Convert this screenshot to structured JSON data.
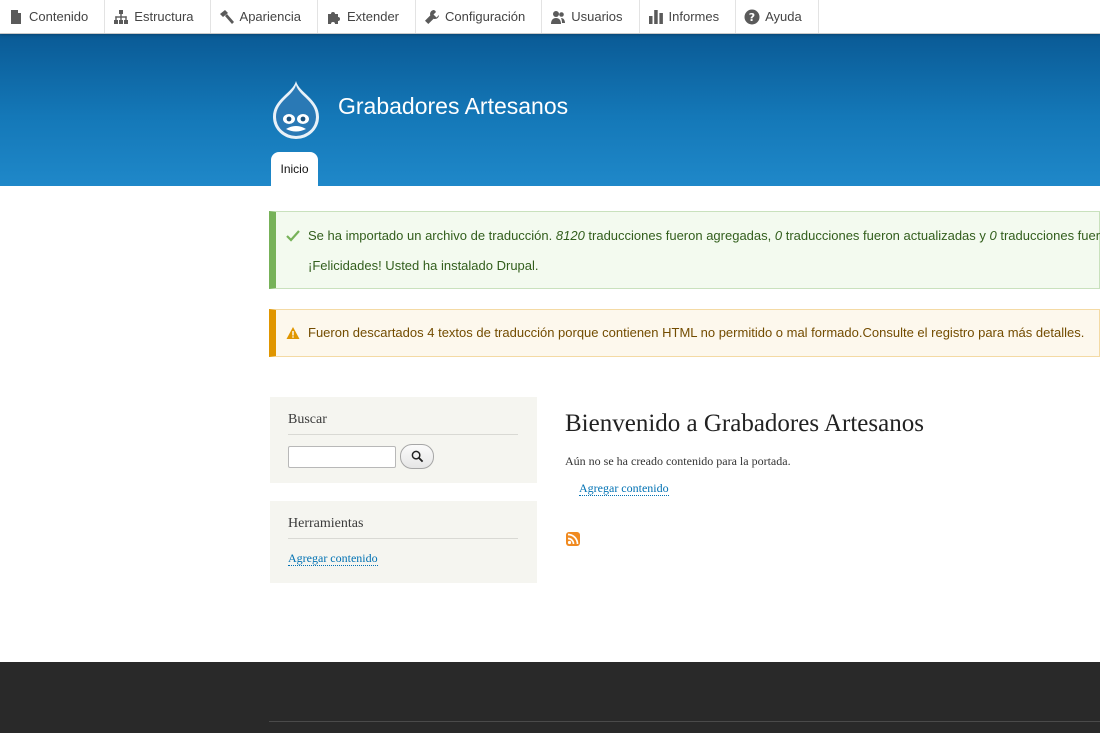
{
  "toolbar": {
    "items": [
      {
        "label": "Contenido",
        "icon": "document-icon"
      },
      {
        "label": "Estructura",
        "icon": "sitemap-icon"
      },
      {
        "label": "Apariencia",
        "icon": "paintbrush-icon"
      },
      {
        "label": "Extender",
        "icon": "puzzle-icon"
      },
      {
        "label": "Configuración",
        "icon": "wrench-icon"
      },
      {
        "label": "Usuarios",
        "icon": "people-icon"
      },
      {
        "label": "Informes",
        "icon": "bar-chart-icon"
      },
      {
        "label": "Ayuda",
        "icon": "help-icon"
      }
    ]
  },
  "header": {
    "site_name": "Grabadores Artesanos",
    "tab_home": "Inicio",
    "logo_icon": "drupal-drop-icon"
  },
  "messages": {
    "status": {
      "part1": "Se ha importado un archivo de traducción. ",
      "added_count": "8120",
      "part2": " traducciones fueron agregadas, ",
      "updated_count": "0",
      "part3": " traducciones fueron actualizadas y ",
      "removed_count": "0",
      "part4": " traducciones fueron",
      "line2": "¡Felicidades! Usted ha instalado Drupal."
    },
    "warning": {
      "text": "Fueron descartados 4 textos de traducción porque contienen HTML no permitido o mal formado.Consulte el registro para más detalles."
    }
  },
  "sidebar": {
    "search": {
      "title": "Buscar",
      "input_value": ""
    },
    "tools": {
      "title": "Herramientas",
      "link": "Agregar contenido"
    }
  },
  "main": {
    "title": "Bienvenido a Grabadores Artesanos",
    "text": "Aún no se ha creado contenido para la portada.",
    "link": "Agregar contenido"
  },
  "colors": {
    "header_dark": "#0a5a95",
    "header_light": "#1f88c9",
    "status_accent": "#77b259",
    "warning_accent": "#e09600",
    "link": "#0071b3",
    "footer": "#292929",
    "rss": "#f08a20"
  }
}
